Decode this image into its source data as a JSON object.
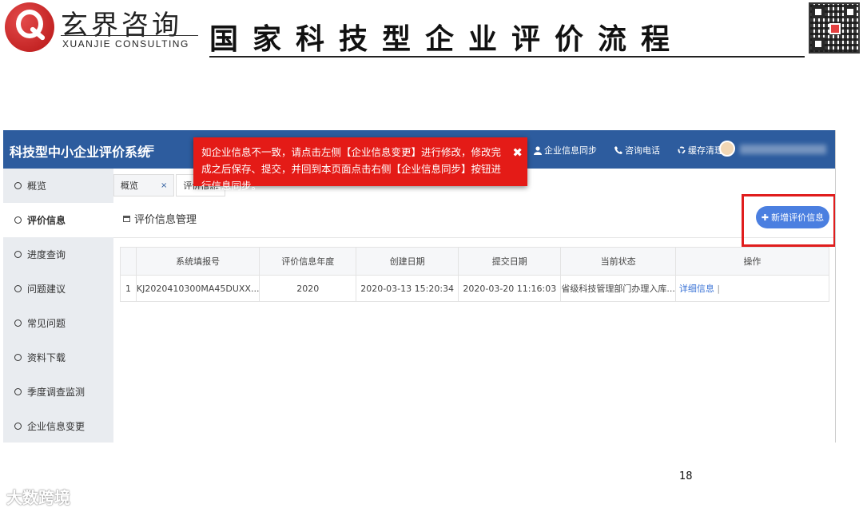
{
  "slide": {
    "logo_cn": "玄界咨询",
    "logo_en": "XUANJIE CONSULTING",
    "title": "国家科技型企业评价流程",
    "page_number": "18",
    "watermark": "大数跨境"
  },
  "app": {
    "title": "科技型中小企业评价系统",
    "menu_icon": "≡",
    "top_actions": [
      {
        "icon": "user-icon",
        "label": "企业信息同步"
      },
      {
        "icon": "phone-icon",
        "label": "咨询电话"
      },
      {
        "icon": "recycle-icon",
        "label": "缓存清理"
      }
    ],
    "sidebar": [
      {
        "label": "概览",
        "active": false
      },
      {
        "label": "评价信息",
        "active": true
      },
      {
        "label": "进度查询",
        "active": false
      },
      {
        "label": "问题建议",
        "active": false
      },
      {
        "label": "常见问题",
        "active": false
      },
      {
        "label": "资料下载",
        "active": false
      },
      {
        "label": "季度调查监测",
        "active": false
      },
      {
        "label": "企业信息变更",
        "active": false
      }
    ],
    "tabs": [
      {
        "label": "概览",
        "close": "×"
      },
      {
        "label": "评价信息"
      }
    ],
    "panel_title": "评价信息管理",
    "add_button": "新增评价信息",
    "table": {
      "headers": [
        "",
        "系统填报号",
        "评价信息年度",
        "创建日期",
        "提交日期",
        "当前状态",
        "操作"
      ],
      "rows": [
        {
          "index": "1",
          "code": "KJ2020410300MA45DUXX...",
          "year": "2020",
          "created": "2020-03-13 15:20:34",
          "submitted": "2020-03-20 11:16:03",
          "status": "省级科技管理部门办理入库...",
          "action": "详细信息",
          "separator": "|"
        }
      ]
    },
    "alert": {
      "text": "如企业信息不一致，请点击左侧【企业信息变更】进行修改，修改完成之后保存、提交，并回到本页面点击右侧【企业信息同步】按钮进行信息同步。",
      "close": "✖"
    },
    "colors": {
      "topbar": "#2d5c9e",
      "alert": "#e41b17",
      "button": "#4b7fe0",
      "highlight": "#e01d1d"
    }
  }
}
